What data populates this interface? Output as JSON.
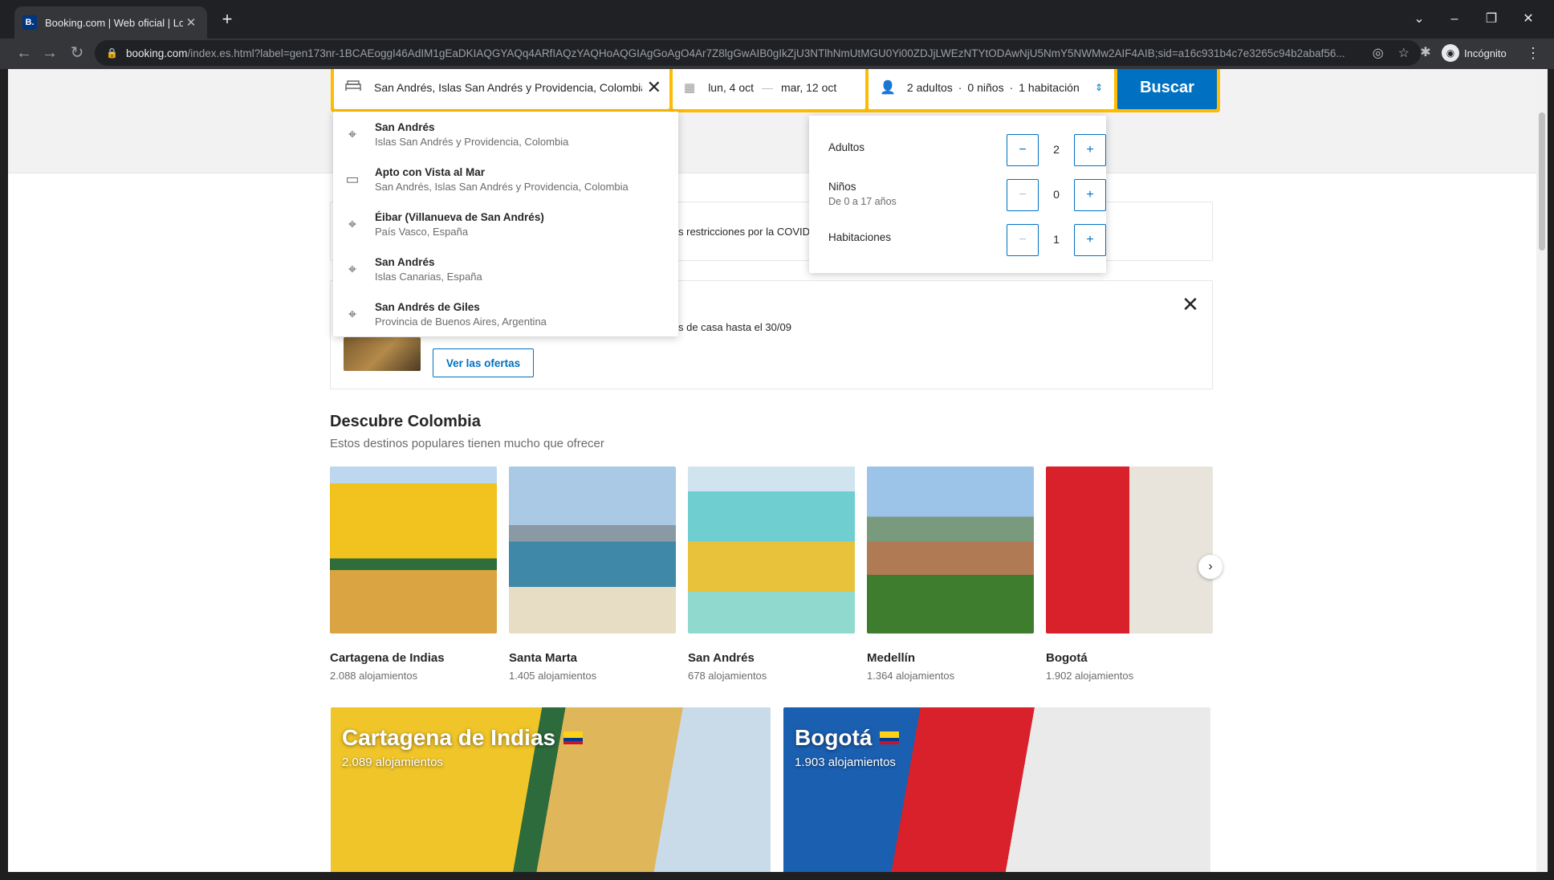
{
  "browser": {
    "tab_title": "Booking.com | Web oficial | Los m",
    "url_host": "booking.com",
    "url_path": "/index.es.html?label=gen173nr-1BCAEoggI46AdIM1gEaDKIAQGYAQq4ARfIAQzYAQHoAQGIAgGoAgO4Ar7Z8lgGwAIB0gIkZjU3NTlhNmUtMGU0Yi00ZDJjLWEzNTYtODAwNjU5NmY5NWMw2AIF4AIB;sid=a16c931b4c7e3265c94b2abaf56...",
    "profile_label": "Incógnito"
  },
  "search": {
    "destination": "San Andrés, Islas San Andrés y Providencia, Colombia",
    "checkin": "lun, 4 oct",
    "checkout": "mar, 12 oct",
    "guests_adults": "2 adultos",
    "guests_children": "0 niños",
    "guests_rooms": "1 habitación",
    "button": "Buscar"
  },
  "autocomplete": [
    {
      "title": "San Andrés",
      "subtitle": "Islas San Andrés y Providencia, Colombia",
      "icon": "map-pin-icon"
    },
    {
      "title": "Apto con Vista al Mar",
      "subtitle": "San Andrés, Islas San Andrés y Providencia, Colombia",
      "icon": "bed-icon"
    },
    {
      "title": "Éibar (Villanueva de San Andrés)",
      "subtitle": "País Vasco, España",
      "icon": "map-pin-icon"
    },
    {
      "title": "San Andrés",
      "subtitle": "Islas Canarias, España",
      "icon": "map-pin-icon"
    },
    {
      "title": "San Andrés de Giles",
      "subtitle": "Provincia de Buenos Aires, Argentina",
      "icon": "map-pin-icon"
    }
  ],
  "guest_panel": {
    "adults_label": "Adultos",
    "adults_value": "2",
    "children_label": "Niños",
    "children_sub": "De 0 a 17 años",
    "children_value": "0",
    "rooms_label": "Habitaciones",
    "rooms_value": "1",
    "minus": "−",
    "plus": "+"
  },
  "covid_text": "s restricciones por la COVID",
  "promo": {
    "text": "s de casa hasta el 30/09",
    "button": "Ver las ofertas"
  },
  "discover": {
    "title": "Descubre Colombia",
    "subtitle": "Estos destinos populares tienen mucho que ofrecer",
    "cards": [
      {
        "name": "Cartagena de Indias",
        "count": "2.088 alojamientos"
      },
      {
        "name": "Santa Marta",
        "count": "1.405 alojamientos"
      },
      {
        "name": "San Andrés",
        "count": "678 alojamientos"
      },
      {
        "name": "Medellín",
        "count": "1.364 alojamientos"
      },
      {
        "name": "Bogotá",
        "count": "1.902 alojamientos"
      }
    ]
  },
  "featured": [
    {
      "name": "Cartagena de Indias",
      "count": "2.089 alojamientos"
    },
    {
      "name": "Bogotá",
      "count": "1.903 alojamientos"
    }
  ],
  "colors": {
    "brand_blue": "#0071c2",
    "search_yellow": "#febb02",
    "dark_blue": "#003580"
  }
}
